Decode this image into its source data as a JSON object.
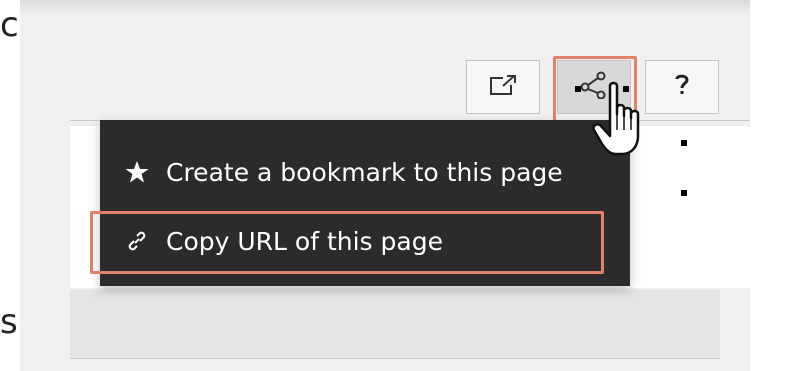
{
  "edge": {
    "top_char": "c",
    "bottom_char": "s"
  },
  "toolbar": {
    "buttons": [
      {
        "icon": "open-in-new-window-icon"
      },
      {
        "icon": "share-icon",
        "active": true
      },
      {
        "icon": "help-icon"
      }
    ]
  },
  "menu": {
    "items": [
      {
        "icon": "star-icon",
        "label": "Create a bookmark to this page"
      },
      {
        "icon": "link-icon",
        "label": "Copy URL of this page",
        "highlighted": true
      }
    ]
  },
  "colors": {
    "highlight": "#e0826a",
    "menu_bg": "#2b2b2b",
    "panel_bg": "#f0f0f0"
  }
}
